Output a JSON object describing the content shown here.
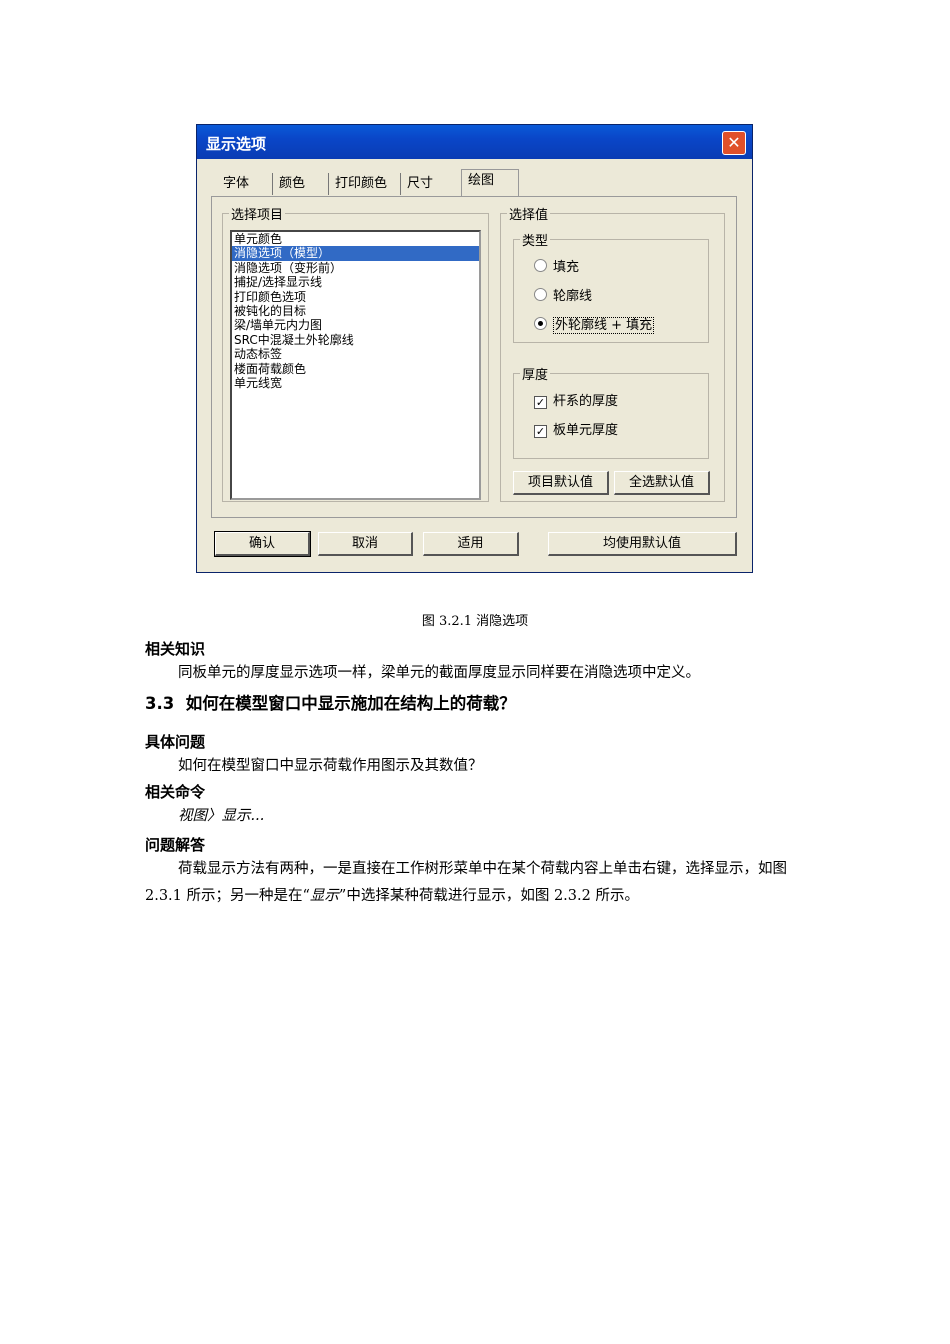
{
  "dialog": {
    "title": "显示选项",
    "close_glyph": "✕",
    "tabs": [
      "字体",
      "颜色",
      "打印颜色",
      "尺寸",
      "绘图"
    ],
    "select_items": {
      "label": "选择项目",
      "items": [
        "单元颜色",
        "消隐选项（模型）",
        "消隐选项（变形前）",
        "捕捉/选择显示线",
        "打印颜色选项",
        "被钝化的目标",
        "梁/墙单元内力图",
        "SRC中混凝土外轮廓线",
        "动态标签",
        "楼面荷载颜色",
        "单元线宽"
      ],
      "selected_index": 1
    },
    "select_value": {
      "label": "选择值",
      "type_group": {
        "label": "类型",
        "options": [
          "填充",
          "轮廓线",
          "外轮廓线 + 填充"
        ],
        "selected_index": 2
      },
      "thickness_group": {
        "label": "厚度",
        "options": [
          "杆系的厚度",
          "板单元厚度"
        ],
        "checked": [
          true,
          true
        ]
      },
      "item_default_button": "项目默认值",
      "all_default_button": "全选默认值"
    },
    "buttons": {
      "ok": "确认",
      "cancel": "取消",
      "apply": "适用",
      "use_defaults": "均使用默认值"
    }
  },
  "document": {
    "caption": "图 3.2.1  消隐选项",
    "related_knowledge_heading": "相关知识",
    "related_knowledge_text": "同板单元的厚度显示选项一样，梁单元的截面厚度显示同样要在消隐选项中定义。",
    "section_number": "3.3",
    "section_title": "如何在模型窗口中显示施加在结构上的荷载？",
    "problem_heading": "具体问题",
    "problem_text": "如何在模型窗口中显示荷载作用图示及其数值？",
    "command_heading": "相关命令",
    "command_text": "视图〉显示...",
    "answer_heading": "问题解答",
    "answer_text_1": "荷载显示方法有两种，一是直接在工作树形菜单中在某个荷载内容上单击右键，选择显示，如图 2.3.1 所示；另一种是在“",
    "answer_text_italic": "显示",
    "answer_text_2": "”中选择某种荷载进行显示，如图 2.3.2 所示。"
  }
}
